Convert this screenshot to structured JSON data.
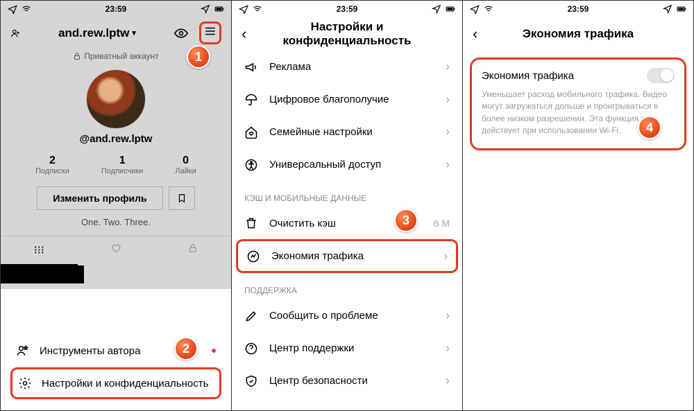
{
  "status": {
    "time": "23:59"
  },
  "phone1": {
    "username": "and.rew.lptw",
    "private_label": "Приватный аккаунт",
    "handle": "@and.rew.lptw",
    "stats": {
      "following": {
        "n": "2",
        "l": "Подписки"
      },
      "followers": {
        "n": "1",
        "l": "Подписчики"
      },
      "likes": {
        "n": "0",
        "l": "Лайки"
      }
    },
    "edit_label": "Изменить профиль",
    "bio": "One. Two. Three.",
    "sheet": {
      "creator": "Инструменты автора",
      "settings": "Настройки и конфиденциальность"
    }
  },
  "phone2": {
    "title": "Настройки и конфиденциальность",
    "rows": {
      "ads": "Реклама",
      "wellbeing": "Цифровое благополучие",
      "family": "Семейные настройки",
      "access": "Универсальный доступ"
    },
    "section_cache": "КЭШ И МОБИЛЬНЫЕ ДАННЫЕ",
    "cache": {
      "clear": "Очистить кэш",
      "size": "6 M",
      "saver": "Экономия трафика"
    },
    "section_support": "ПОДДЕРЖКА",
    "support": {
      "report": "Сообщить о проблеме",
      "help": "Центр поддержки",
      "safety": "Центр безопасности"
    }
  },
  "phone3": {
    "title": "Экономия трафика",
    "toggle_label": "Экономия трафика",
    "desc": "Уменьшает расход мобильного трафика. Видео могут загружаться дольше и проигрываться в более низком разрешении. Эта функция не действует при использовании Wi-Fi."
  },
  "badges": {
    "b1": "1",
    "b2": "2",
    "b3": "3",
    "b4": "4"
  }
}
